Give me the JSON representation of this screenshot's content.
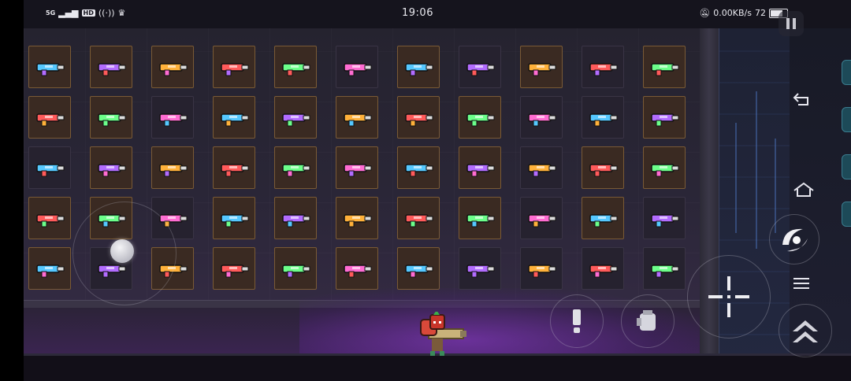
{
  "status_bar": {
    "network": "5G",
    "hd_badge": "HD",
    "time": "19:06",
    "speed": "0.00KB/s",
    "battery": "72"
  },
  "weapon_grid": {
    "rows": 5,
    "columns": 11,
    "owned_slots": [
      [
        true,
        true,
        true,
        true,
        true,
        false,
        true,
        false,
        true,
        false,
        true
      ],
      [
        true,
        true,
        false,
        true,
        true,
        true,
        true,
        true,
        false,
        false,
        true
      ],
      [
        false,
        true,
        true,
        true,
        true,
        true,
        true,
        true,
        false,
        true,
        true
      ],
      [
        true,
        true,
        false,
        true,
        true,
        true,
        true,
        true,
        false,
        true,
        false
      ],
      [
        true,
        false,
        true,
        true,
        true,
        true,
        true,
        false,
        false,
        false,
        false
      ]
    ],
    "accent_colors": [
      "#55c8ff",
      "#b26cff",
      "#ffb13a",
      "#ff5a5a",
      "#6cff8a",
      "#ff6cd2"
    ]
  },
  "controls": {
    "joystick": "movement-joystick",
    "aim_button": "crosshair-icon",
    "skill_button": "dash-swirl-icon",
    "swap_weapon_button": "weapon-swap-icon",
    "interact_button": "exclamation-icon",
    "jump_button": "double-chevron-up-icon",
    "pause_button": "pause-icon"
  },
  "system_nav": {
    "back": "back-icon",
    "home": "home-icon",
    "menu": "menu-icon"
  }
}
